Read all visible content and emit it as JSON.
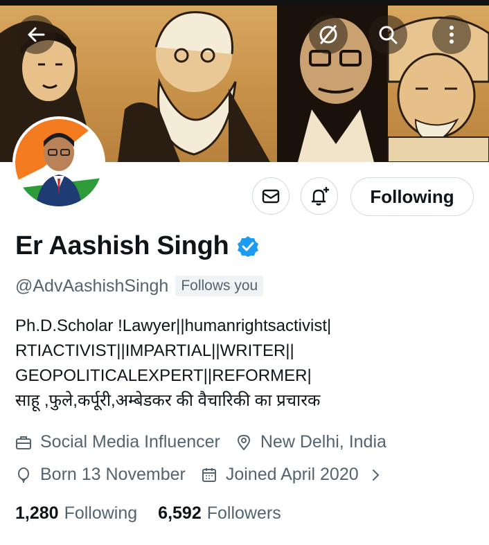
{
  "header": {
    "back_icon": "arrow-left-icon",
    "actions": [
      "grok-icon",
      "search-icon",
      "more-vertical-icon"
    ]
  },
  "profile": {
    "display_name": "Er Aashish Singh",
    "verified": true,
    "handle": "@AdvAashishSingh",
    "follows_you": "Follows you",
    "bio_lines": [
      "Ph.D.Scholar !Lawyer||humanrightsactivist|",
      "RTIACTIVIST||IMPARTIAL||WRITER||",
      "GEOPOLITICALEXPERT||REFORMER|",
      "साहू ,फुले,कर्पूरी,अम्बेडकर की वैचारिकी का प्रचारक"
    ],
    "category": "Social Media Influencer",
    "location": "New Delhi, India",
    "birthday": "Born 13 November",
    "joined": "Joined April 2020",
    "following_count": "1,280",
    "following_label": "Following",
    "followers_count": "6,592",
    "followers_label": "Followers"
  },
  "buttons": {
    "message_icon": "envelope-icon",
    "notify_icon": "bell-plus-icon",
    "following_label": "Following"
  },
  "colors": {
    "verified_blue": "#1d9bf0",
    "secondary_text": "#536471",
    "border": "#cfd9de"
  }
}
